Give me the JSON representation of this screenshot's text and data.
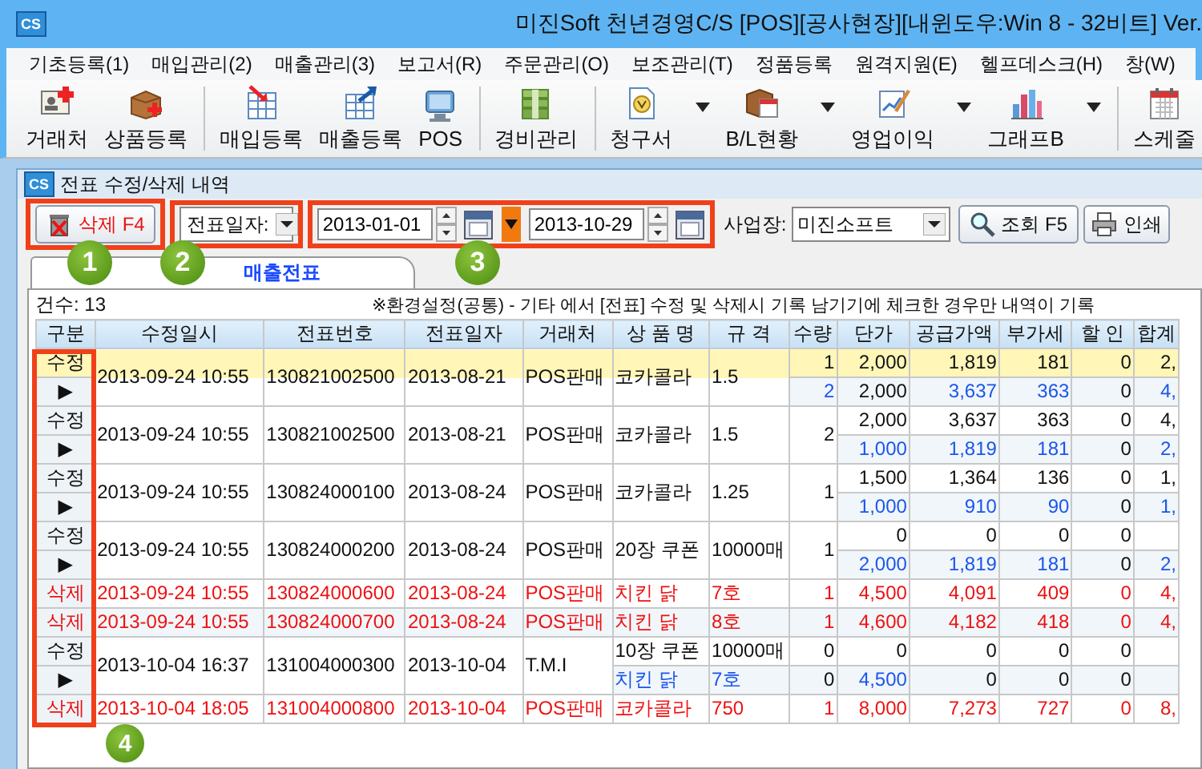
{
  "window": {
    "icon_label": "CS",
    "title": "미진Soft 천년경영C/S [POS][공사현장][내윈도우:Win 8 - 32비트] Ver."
  },
  "menu": [
    "기초등록(1)",
    "매입관리(2)",
    "매출관리(3)",
    "보고서(R)",
    "주문관리(O)",
    "보조관리(T)",
    "정품등록",
    "원격지원(E)",
    "헬프데스크(H)",
    "창(W)"
  ],
  "toolbar": [
    {
      "label": "거래처",
      "kind": "card",
      "dropdown": false,
      "separator_before": false
    },
    {
      "label": "상품등록",
      "kind": "box",
      "dropdown": false,
      "separator_before": false
    },
    {
      "label": "매입등록",
      "kind": "purchase",
      "dropdown": false,
      "separator_before": true
    },
    {
      "label": "매출등록",
      "kind": "sales",
      "dropdown": false,
      "separator_before": false
    },
    {
      "label": "POS",
      "kind": "pos",
      "dropdown": false,
      "separator_before": false
    },
    {
      "label": "경비관리",
      "kind": "expense",
      "dropdown": false,
      "separator_before": true
    },
    {
      "label": "청구서",
      "kind": "invoice",
      "dropdown": true,
      "separator_before": true
    },
    {
      "label": "B/L현황",
      "kind": "shipment",
      "dropdown": true,
      "separator_before": false
    },
    {
      "label": "영업이익",
      "kind": "profit",
      "dropdown": true,
      "separator_before": false
    },
    {
      "label": "그래프B",
      "kind": "graph",
      "dropdown": true,
      "separator_before": false
    },
    {
      "label": "스케줄",
      "kind": "schedule",
      "dropdown": false,
      "separator_before": true
    }
  ],
  "child_window": {
    "icon_label": "CS",
    "title": "전표 수정/삭제 내역"
  },
  "filters": {
    "delete_button": "삭제 F4",
    "date_type": "전표일자:",
    "date_from": "2013-01-01",
    "date_to": "2013-10-29",
    "site_label": "사업장:",
    "site": "미진소프트",
    "search_button": "조회 F5",
    "print_button": "인쇄"
  },
  "tabs": [
    {
      "label": "매출전표",
      "selected": true
    }
  ],
  "count": "건수: 13",
  "note": "※환경설정(공통) - 기타 에서 [전표] 수정 및 삭제시 기록 남기기에 체크한 경우만 내역이 기록",
  "table": {
    "columns": [
      "구분",
      "수정일시",
      "전표번호",
      "전표일자",
      "거래처",
      "상 품 명",
      "규 격",
      "수량",
      "단가",
      "공급가액",
      "부가세",
      "할 인",
      "합계"
    ],
    "groups": [
      {
        "kind": "edit",
        "selected": true,
        "lines": [
          [
            "수정",
            {
              "text": "2013-09-24 10:55",
              "merged": true
            },
            {
              "text": "130821002500",
              "merged": true
            },
            {
              "text": "2013-08-21",
              "merged": true
            },
            {
              "text": "POS판매",
              "merged": true
            },
            {
              "text": "코카콜라",
              "merged": true
            },
            {
              "text": "1.5",
              "merged": true
            },
            "1",
            "2,000",
            "1,819",
            "181",
            "0",
            "2,"
          ],
          [
            "▶",
            {
              "text": "2",
              "changed": true
            },
            "2,000",
            {
              "text": "3,637",
              "changed": true
            },
            {
              "text": "363",
              "changed": true
            },
            "0",
            {
              "text": "4,",
              "changed": true
            }
          ]
        ]
      },
      {
        "kind": "edit",
        "selected": false,
        "lines": [
          [
            "수정",
            {
              "text": "2013-09-24 10:55",
              "merged": true
            },
            {
              "text": "130821002500",
              "merged": true
            },
            {
              "text": "2013-08-21",
              "merged": true
            },
            {
              "text": "POS판매",
              "merged": true
            },
            {
              "text": "코카콜라",
              "merged": true
            },
            {
              "text": "1.5",
              "merged": true
            },
            {
              "text": "2",
              "merged": true
            },
            "2,000",
            "3,637",
            "363",
            "0",
            "4,"
          ],
          [
            "▶",
            {
              "text": "1,000",
              "changed": true
            },
            {
              "text": "1,819",
              "changed": true
            },
            {
              "text": "181",
              "changed": true
            },
            "0",
            {
              "text": "2,",
              "changed": true
            }
          ]
        ]
      },
      {
        "kind": "edit",
        "selected": false,
        "lines": [
          [
            "수정",
            {
              "text": "2013-09-24 10:55",
              "merged": true
            },
            {
              "text": "130824000100",
              "merged": true
            },
            {
              "text": "2013-08-24",
              "merged": true
            },
            {
              "text": "POS판매",
              "merged": true
            },
            {
              "text": "코카콜라",
              "merged": true
            },
            {
              "text": "1.25",
              "merged": true
            },
            {
              "text": "1",
              "merged": true
            },
            "1,500",
            "1,364",
            "136",
            "0",
            "1,"
          ],
          [
            "▶",
            {
              "text": "1,000",
              "changed": true
            },
            {
              "text": "910",
              "changed": true
            },
            {
              "text": "90",
              "changed": true
            },
            "0",
            {
              "text": "1,",
              "changed": true
            }
          ]
        ]
      },
      {
        "kind": "edit",
        "selected": false,
        "lines": [
          [
            "수정",
            {
              "text": "2013-09-24 10:55",
              "merged": true
            },
            {
              "text": "130824000200",
              "merged": true
            },
            {
              "text": "2013-08-24",
              "merged": true
            },
            {
              "text": "POS판매",
              "merged": true
            },
            {
              "text": "20장 쿠폰",
              "merged": true
            },
            {
              "text": "10000매",
              "merged": true
            },
            {
              "text": "1",
              "merged": true
            },
            "0",
            "0",
            "0",
            "0",
            {
              "kind": "blank"
            }
          ],
          [
            "▶",
            {
              "text": "2,000",
              "changed": true
            },
            {
              "text": "1,819",
              "changed": true
            },
            {
              "text": "181",
              "changed": true
            },
            "0",
            {
              "text": "2,",
              "changed": true
            }
          ]
        ]
      },
      {
        "kind": "delete",
        "selected": false,
        "lines": [
          [
            "삭제",
            "2013-09-24 10:55",
            "130824000600",
            "2013-08-24",
            "POS판매",
            "치킨 닭",
            "7호",
            "1",
            "4,500",
            "4,091",
            "409",
            "0",
            "4,"
          ]
        ]
      },
      {
        "kind": "delete",
        "selected": false,
        "lines": [
          [
            "삭제",
            "2013-09-24 10:55",
            "130824000700",
            "2013-08-24",
            "POS판매",
            "치킨 닭",
            "8호",
            "1",
            "4,600",
            "4,182",
            "418",
            "0",
            "4,"
          ]
        ]
      },
      {
        "kind": "edit",
        "selected": false,
        "lines": [
          [
            "수정",
            {
              "text": "2013-10-04 16:37",
              "merged": true
            },
            {
              "text": "131004000300",
              "merged": true
            },
            {
              "text": "2013-10-04",
              "merged": true
            },
            {
              "text": "T.M.I",
              "merged": true
            },
            "10장 쿠폰",
            "10000매",
            "0",
            "0",
            "0",
            "0",
            "0",
            {
              "kind": "blank"
            }
          ],
          [
            "▶",
            {
              "text": "치킨 닭",
              "changed": true
            },
            {
              "text": "7호",
              "changed": true
            },
            "0",
            {
              "text": "4,500",
              "changed": true
            },
            "0",
            "0",
            "0",
            {
              "kind": "blank"
            }
          ]
        ]
      },
      {
        "kind": "delete",
        "selected": false,
        "lines": [
          [
            "삭제",
            "2013-10-04 18:05",
            "131004000800",
            "2013-10-04",
            "POS판매",
            "코카콜라",
            "750",
            "1",
            "8,000",
            "7,273",
            "727",
            "0",
            "8,"
          ]
        ]
      }
    ]
  },
  "callouts": [
    "1",
    "2",
    "3",
    "4"
  ]
}
